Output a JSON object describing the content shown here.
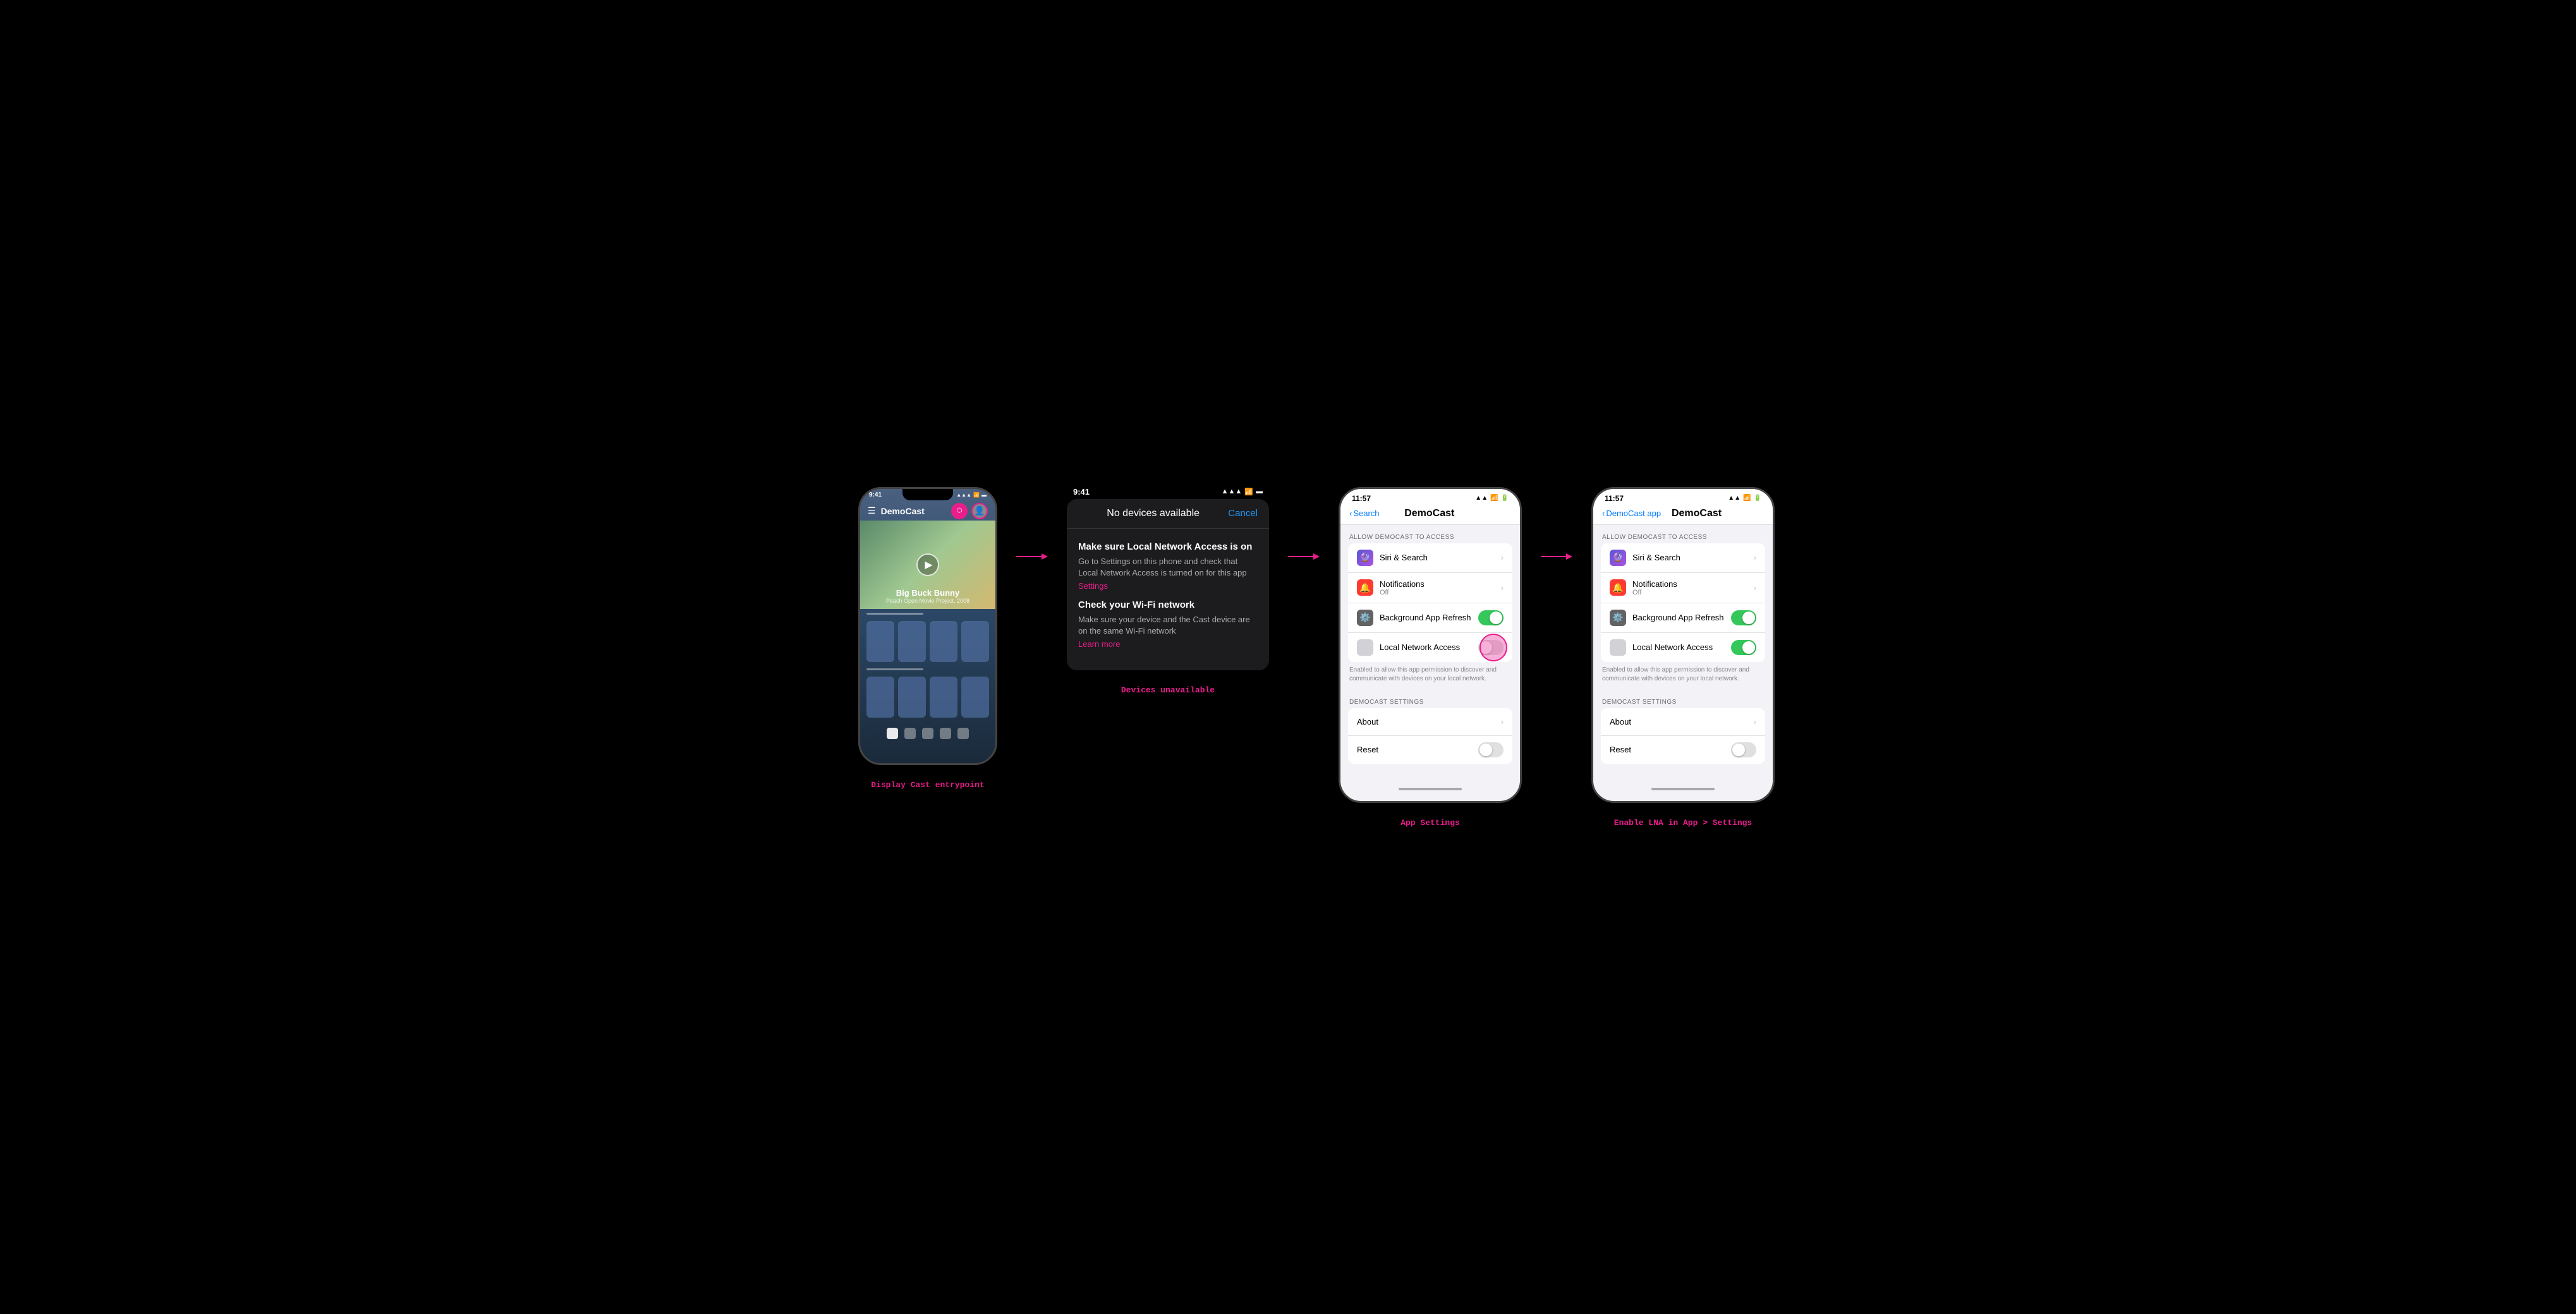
{
  "phone1": {
    "time": "9:41",
    "title": "DemoCast",
    "movie_title": "Big Buck Bunny",
    "movie_sub": "Peach Open Movie Project, 2008"
  },
  "popup": {
    "time": "9:41",
    "title": "No devices available",
    "cancel": "Cancel",
    "troubleshoot1_title": "Make sure Local Network Access is on",
    "troubleshoot1_body": "Go to Settings on this phone and check that Local Network Access is turned on for this app",
    "settings_link": "Settings",
    "troubleshoot2_title": "Check your Wi-Fi network",
    "troubleshoot2_body": "Make sure your device and the Cast device are on the same Wi-Fi network",
    "learn_more": "Learn more"
  },
  "settings1": {
    "time": "11:57",
    "back_label": "Search",
    "nav_title": "DemoCast",
    "section_header": "ALLOW DEMOCAST TO ACCESS",
    "siri_label": "Siri & Search",
    "notif_label": "Notifications",
    "notif_sub": "Off",
    "refresh_label": "Background App Refresh",
    "network_label": "Local Network Access",
    "network_note": "Enabled to allow this app permission to discover and communicate with devices on your local network.",
    "section2_header": "DEMOCAST SETTINGS",
    "about_label": "About",
    "reset_label": "Reset"
  },
  "settings2": {
    "time": "11:57",
    "back_label": "DemoCast app",
    "nav_title": "DemoCast",
    "section_header": "ALLOW DEMOCAST TO ACCESS",
    "siri_label": "Siri & Search",
    "notif_label": "Notifications",
    "notif_sub": "Off",
    "refresh_label": "Background App Refresh",
    "network_label": "Local Network Access",
    "network_note": "Enabled to allow this app permission to discover and communicate with devices on your local network.",
    "section2_header": "DEMOCAST SETTINGS",
    "about_label": "About",
    "reset_label": "Reset"
  },
  "captions": {
    "caption1": "Display Cast entrypoint",
    "caption2": "Devices unavailable",
    "caption3": "App Settings",
    "caption4": "Enable LNA in App > Settings"
  },
  "arrows": {
    "right": "→"
  }
}
